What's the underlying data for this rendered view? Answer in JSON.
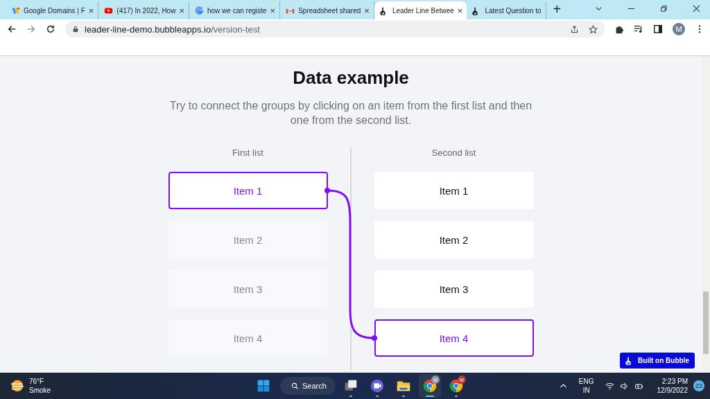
{
  "tabs": [
    {
      "title": "Google Domains | F",
      "close": "×",
      "selected": false
    },
    {
      "title": "(417) In 2022, How",
      "close": "×",
      "selected": false
    },
    {
      "title": "how we can registe",
      "close": "×",
      "selected": false
    },
    {
      "title": "Spreadsheet shared",
      "close": "×",
      "selected": false
    },
    {
      "title": "Leader Line Betwee",
      "close": "×",
      "selected": true
    },
    {
      "title": "Latest Question to",
      "selected": false
    }
  ],
  "new_tab": "+",
  "address_bar": {
    "host": "leader-line-demo.bubbleapps.io",
    "path": "/version-test"
  },
  "profile": "M",
  "page": {
    "title": "Data example",
    "subtitle": "Try to connect the groups by clicking on an item from the first list and then one from the second list.",
    "first_list": {
      "heading": "First list",
      "items": [
        {
          "label": "Item 1",
          "selected": true,
          "dimmed": false
        },
        {
          "label": "Item 2",
          "selected": false,
          "dimmed": true
        },
        {
          "label": "Item 3",
          "selected": false,
          "dimmed": true
        },
        {
          "label": "Item 4",
          "selected": false,
          "dimmed": true
        }
      ]
    },
    "second_list": {
      "heading": "Second list",
      "items": [
        {
          "label": "Item 1",
          "selected": false,
          "dimmed": false
        },
        {
          "label": "Item 2",
          "selected": false,
          "dimmed": false
        },
        {
          "label": "Item 3",
          "selected": false,
          "dimmed": false
        },
        {
          "label": "Item 4",
          "selected": true,
          "dimmed": false
        }
      ]
    },
    "badge": "Built on Bubble"
  },
  "taskbar": {
    "weather": {
      "temp": "76°F",
      "condition": "Smoke"
    },
    "search": "Search",
    "apps": [
      {
        "kind": "taskview",
        "active": false
      },
      {
        "kind": "meet",
        "active": false
      },
      {
        "kind": "explorer",
        "active": false
      },
      {
        "kind": "chrome",
        "badge": "M",
        "active": true
      },
      {
        "kind": "chrome",
        "badge": "M",
        "active": false
      }
    ],
    "language": [
      "ENG",
      "IN"
    ],
    "time": "2:23 PM",
    "date": "12/9/2022",
    "notifications": "23"
  }
}
